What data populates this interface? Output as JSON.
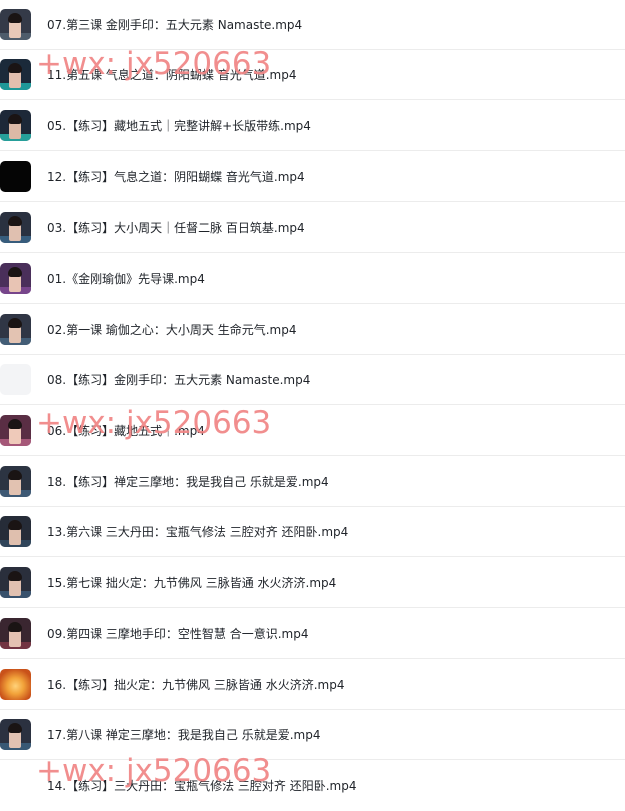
{
  "files": [
    {
      "name": "07.第三课 金刚手印：五大元素 Namaste.mp4",
      "thumb": "person-dark",
      "bg": "#343a48",
      "skin": "#e7c8b8",
      "accent": "#5a6b7a"
    },
    {
      "name": "11.第五课 气息之道：阴阳蝴蝶 音光气道.mp4",
      "thumb": "person-neon",
      "bg": "#1b2a3a",
      "skin": "#e2bfae",
      "accent": "#1fc7c0"
    },
    {
      "name": "05.【练习】藏地五式｜完整讲解+长版带练.mp4",
      "thumb": "person-neon",
      "bg": "#1d2838",
      "skin": "#dcb9a6",
      "accent": "#2bd1c4"
    },
    {
      "name": "12.【练习】气息之道：阴阳蝴蝶 音光气道.mp4",
      "thumb": "dark",
      "bg": "#050505",
      "skin": "#050505",
      "accent": "#0b0b0b"
    },
    {
      "name": "03.【练习】大小周天｜任督二脉 百日筑基.mp4",
      "thumb": "person-dark",
      "bg": "#2a3140",
      "skin": "#e0c0b0",
      "accent": "#3d6f96"
    },
    {
      "name": "01.《金刚瑜伽》先导课.mp4",
      "thumb": "person-purple",
      "bg": "#4a2f5a",
      "skin": "#e8c4b4",
      "accent": "#8a4fa0"
    },
    {
      "name": "02.第一课 瑜伽之心：大小周天 生命元气.mp4",
      "thumb": "person-dark",
      "bg": "#303645",
      "skin": "#e3c3b2",
      "accent": "#4b6d8c"
    },
    {
      "name": "08.【练习】金刚手印：五大元素 Namaste.mp4",
      "thumb": "blank",
      "bg": "#f3f4f6",
      "skin": "#f3f4f6",
      "accent": "#eceef1"
    },
    {
      "name": "06.【练习】藏地五式｜.mp4",
      "thumb": "person-pink",
      "bg": "#5a2e44",
      "skin": "#efcaba",
      "accent": "#c46a8f"
    },
    {
      "name": "18.【练习】禅定三摩地：我是我自己 乐就是爱.mp4",
      "thumb": "person-dark",
      "bg": "#2c3442",
      "skin": "#e2c2b1",
      "accent": "#466a8a"
    },
    {
      "name": "13.第六课 三大丹田：宝瓶气修法 三腔对齐 还阳卧.mp4",
      "thumb": "person-dark",
      "bg": "#262c38",
      "skin": "#dfbfae",
      "accent": "#35506a"
    },
    {
      "name": "15.第七课 拙火定：九节佛风 三脉皆通 水火济济.mp4",
      "thumb": "person-dark",
      "bg": "#2a2f3c",
      "skin": "#e0c0b0",
      "accent": "#3f5f80"
    },
    {
      "name": "09.第四课 三摩地手印：空性智慧 合一意识.mp4",
      "thumb": "person-red",
      "bg": "#3a2630",
      "skin": "#e4c2b2",
      "accent": "#8a3a4a"
    },
    {
      "name": "16.【练习】拙火定：九节佛风 三脉皆通 水火济济.mp4",
      "thumb": "fire",
      "bg": "#c9521a",
      "skin": "#ffd27a",
      "accent": "#f2a33a"
    },
    {
      "name": "17.第八课 禅定三摩地：我是我自己 乐就是爱.mp4",
      "thumb": "person-dark",
      "bg": "#2b3140",
      "skin": "#e2c2b2",
      "accent": "#3f6a8a"
    },
    {
      "name": "14.【练习】三大丹田：宝瓶气修法 三腔对齐 还阳卧.mp4",
      "thumb": "none",
      "bg": "#ffffff",
      "skin": "#ffffff",
      "accent": "#ffffff"
    }
  ],
  "watermarks": [
    {
      "text": "+wx: jx520663"
    },
    {
      "text": "+wx: jx520663"
    },
    {
      "text": "+wx: jx520663"
    }
  ]
}
